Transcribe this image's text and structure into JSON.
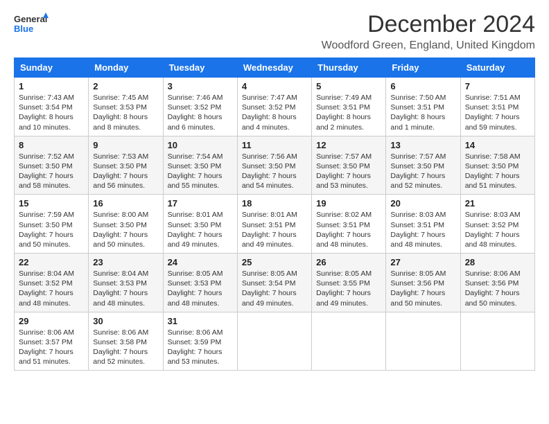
{
  "header": {
    "logo_general": "General",
    "logo_blue": "Blue",
    "month_title": "December 2024",
    "location": "Woodford Green, England, United Kingdom"
  },
  "columns": [
    "Sunday",
    "Monday",
    "Tuesday",
    "Wednesday",
    "Thursday",
    "Friday",
    "Saturday"
  ],
  "weeks": [
    [
      {
        "day": "1",
        "sunrise": "7:43 AM",
        "sunset": "3:54 PM",
        "daylight": "8 hours and 10 minutes."
      },
      {
        "day": "2",
        "sunrise": "7:45 AM",
        "sunset": "3:53 PM",
        "daylight": "8 hours and 8 minutes."
      },
      {
        "day": "3",
        "sunrise": "7:46 AM",
        "sunset": "3:52 PM",
        "daylight": "8 hours and 6 minutes."
      },
      {
        "day": "4",
        "sunrise": "7:47 AM",
        "sunset": "3:52 PM",
        "daylight": "8 hours and 4 minutes."
      },
      {
        "day": "5",
        "sunrise": "7:49 AM",
        "sunset": "3:51 PM",
        "daylight": "8 hours and 2 minutes."
      },
      {
        "day": "6",
        "sunrise": "7:50 AM",
        "sunset": "3:51 PM",
        "daylight": "8 hours and 1 minute."
      },
      {
        "day": "7",
        "sunrise": "7:51 AM",
        "sunset": "3:51 PM",
        "daylight": "7 hours and 59 minutes."
      }
    ],
    [
      {
        "day": "8",
        "sunrise": "7:52 AM",
        "sunset": "3:50 PM",
        "daylight": "7 hours and 58 minutes."
      },
      {
        "day": "9",
        "sunrise": "7:53 AM",
        "sunset": "3:50 PM",
        "daylight": "7 hours and 56 minutes."
      },
      {
        "day": "10",
        "sunrise": "7:54 AM",
        "sunset": "3:50 PM",
        "daylight": "7 hours and 55 minutes."
      },
      {
        "day": "11",
        "sunrise": "7:56 AM",
        "sunset": "3:50 PM",
        "daylight": "7 hours and 54 minutes."
      },
      {
        "day": "12",
        "sunrise": "7:57 AM",
        "sunset": "3:50 PM",
        "daylight": "7 hours and 53 minutes."
      },
      {
        "day": "13",
        "sunrise": "7:57 AM",
        "sunset": "3:50 PM",
        "daylight": "7 hours and 52 minutes."
      },
      {
        "day": "14",
        "sunrise": "7:58 AM",
        "sunset": "3:50 PM",
        "daylight": "7 hours and 51 minutes."
      }
    ],
    [
      {
        "day": "15",
        "sunrise": "7:59 AM",
        "sunset": "3:50 PM",
        "daylight": "7 hours and 50 minutes."
      },
      {
        "day": "16",
        "sunrise": "8:00 AM",
        "sunset": "3:50 PM",
        "daylight": "7 hours and 50 minutes."
      },
      {
        "day": "17",
        "sunrise": "8:01 AM",
        "sunset": "3:50 PM",
        "daylight": "7 hours and 49 minutes."
      },
      {
        "day": "18",
        "sunrise": "8:01 AM",
        "sunset": "3:51 PM",
        "daylight": "7 hours and 49 minutes."
      },
      {
        "day": "19",
        "sunrise": "8:02 AM",
        "sunset": "3:51 PM",
        "daylight": "7 hours and 48 minutes."
      },
      {
        "day": "20",
        "sunrise": "8:03 AM",
        "sunset": "3:51 PM",
        "daylight": "7 hours and 48 minutes."
      },
      {
        "day": "21",
        "sunrise": "8:03 AM",
        "sunset": "3:52 PM",
        "daylight": "7 hours and 48 minutes."
      }
    ],
    [
      {
        "day": "22",
        "sunrise": "8:04 AM",
        "sunset": "3:52 PM",
        "daylight": "7 hours and 48 minutes."
      },
      {
        "day": "23",
        "sunrise": "8:04 AM",
        "sunset": "3:53 PM",
        "daylight": "7 hours and 48 minutes."
      },
      {
        "day": "24",
        "sunrise": "8:05 AM",
        "sunset": "3:53 PM",
        "daylight": "7 hours and 48 minutes."
      },
      {
        "day": "25",
        "sunrise": "8:05 AM",
        "sunset": "3:54 PM",
        "daylight": "7 hours and 49 minutes."
      },
      {
        "day": "26",
        "sunrise": "8:05 AM",
        "sunset": "3:55 PM",
        "daylight": "7 hours and 49 minutes."
      },
      {
        "day": "27",
        "sunrise": "8:05 AM",
        "sunset": "3:56 PM",
        "daylight": "7 hours and 50 minutes."
      },
      {
        "day": "28",
        "sunrise": "8:06 AM",
        "sunset": "3:56 PM",
        "daylight": "7 hours and 50 minutes."
      }
    ],
    [
      {
        "day": "29",
        "sunrise": "8:06 AM",
        "sunset": "3:57 PM",
        "daylight": "7 hours and 51 minutes."
      },
      {
        "day": "30",
        "sunrise": "8:06 AM",
        "sunset": "3:58 PM",
        "daylight": "7 hours and 52 minutes."
      },
      {
        "day": "31",
        "sunrise": "8:06 AM",
        "sunset": "3:59 PM",
        "daylight": "7 hours and 53 minutes."
      },
      null,
      null,
      null,
      null
    ]
  ]
}
